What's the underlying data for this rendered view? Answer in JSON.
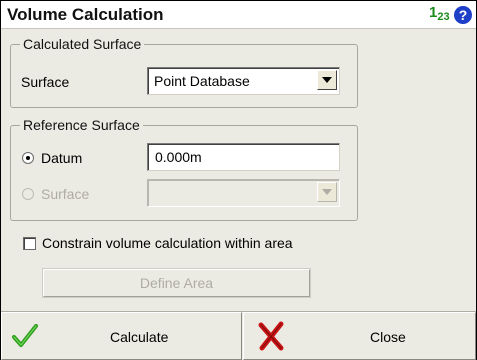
{
  "window": {
    "title": "Volume Calculation",
    "number_icon": {
      "main": "1",
      "sub": "23",
      "semantic": "numeric-input-mode-icon"
    },
    "help_icon": "?"
  },
  "calculated_surface": {
    "legend": "Calculated Surface",
    "surface_label": "Surface",
    "surface_value": "Point Database"
  },
  "reference_surface": {
    "legend": "Reference Surface",
    "datum_label": "Datum",
    "datum_selected": true,
    "datum_value": "0.000m",
    "surface_label": "Surface",
    "surface_value": ""
  },
  "constrain": {
    "label": "Constrain volume calculation within area",
    "checked": false
  },
  "define_area_label": "Define Area",
  "actions": {
    "calculate_label": "Calculate",
    "close_label": "Close"
  },
  "colors": {
    "check_green": "#2e9e1c",
    "close_red": "#c81414",
    "help_blue": "#1e3fc8",
    "number_green": "#1b8b1b",
    "window_bg": "#ecebe3"
  }
}
